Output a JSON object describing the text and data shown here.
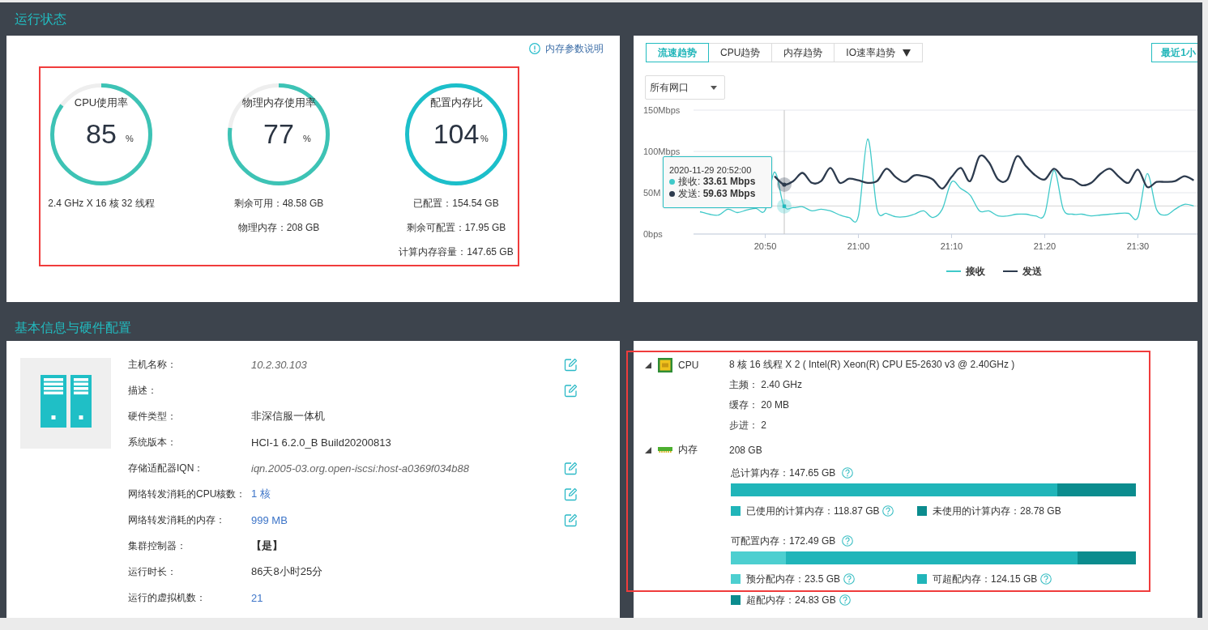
{
  "runtime": {
    "title": "运行状态",
    "help_link": "内存参数说明",
    "highlighted": true,
    "gauges": [
      {
        "label": "CPU使用率",
        "value": "85",
        "unit": "%",
        "level": 0.85,
        "color": "#3dc3b5",
        "details": [
          "2.4 GHz X 16 核 32 线程"
        ]
      },
      {
        "label": "物理内存使用率",
        "value": "77",
        "unit": "%",
        "level": 0.77,
        "color": "#3dc3b5",
        "details": [
          "剩余可用：48.58 GB",
          "物理内存：208 GB"
        ]
      },
      {
        "label": "配置内存比",
        "value": "104",
        "unit": "%",
        "level": 1,
        "color": "#1cbfca",
        "details": [
          "已配置：154.54 GB",
          "剩余可配置：17.95 GB",
          "计算内存容量：147.65 GB"
        ]
      }
    ]
  },
  "trend": {
    "tabs": [
      {
        "label": "流速趋势",
        "selected": true,
        "kind": "tab"
      },
      {
        "label": "CPU趋势",
        "selected": false,
        "kind": "tab"
      },
      {
        "label": "内存趋势",
        "selected": false,
        "kind": "tab"
      },
      {
        "label": "IO速率趋势",
        "selected": false,
        "kind": "dropdown"
      }
    ],
    "time_range": "最近1小",
    "interface_select": "所有网口",
    "chart_data": {
      "type": "line",
      "categories": [
        null,
        null,
        null,
        null,
        null,
        null,
        null,
        "20:50",
        null,
        null,
        null,
        null,
        null,
        null,
        null,
        null,
        null,
        "21:00",
        null,
        null,
        null,
        null,
        null,
        null,
        null,
        null,
        null,
        "21:10",
        null,
        null,
        null,
        null,
        null,
        null,
        null,
        null,
        null,
        "21:20",
        null,
        null,
        null,
        null,
        null,
        null,
        null,
        null,
        null,
        "21:30",
        null,
        null,
        null,
        null,
        null,
        null
      ],
      "ylim": [
        0,
        150
      ],
      "yticks": [
        {
          "value": 0,
          "label": "0bps"
        },
        {
          "value": 50,
          "label": "50M"
        },
        {
          "value": 100,
          "label": "100Mbps"
        },
        {
          "value": 150,
          "label": "150Mbps"
        }
      ],
      "legend": "bottom",
      "series": [
        {
          "name": "接收",
          "color": "#3fc9c9",
          "values": [
            27,
            24,
            23,
            30,
            26,
            29,
            31,
            29,
            75,
            34,
            32,
            33,
            28,
            30,
            28,
            23,
            20,
            22,
            115,
            30,
            25,
            21,
            21,
            24,
            28,
            20,
            30,
            63,
            55,
            47,
            28,
            28,
            22,
            22,
            24,
            24,
            22,
            24,
            77,
            30,
            24,
            24,
            22,
            23,
            24,
            25,
            25,
            20,
            73,
            30,
            23,
            30,
            36,
            34
          ]
        },
        {
          "name": "发送",
          "color": "#2d3b4e",
          "values": [
            null,
            null,
            null,
            null,
            null,
            null,
            null,
            null,
            70,
            60,
            64,
            74,
            62,
            64,
            80,
            62,
            67,
            65,
            62,
            64,
            79,
            69,
            63,
            71,
            70,
            66,
            55,
            69,
            80,
            64,
            94,
            87,
            66,
            66,
            94,
            82,
            71,
            66,
            79,
            68,
            66,
            59,
            62,
            73,
            79,
            69,
            62,
            78,
            57,
            63,
            63,
            64,
            70,
            65
          ]
        }
      ],
      "ref_lines": [
        {
          "axis": "y",
          "value": 34
        }
      ]
    },
    "tooltip": {
      "title": "2020-11-29 20:52:00",
      "rows": [
        "接收: **33.61 Mbps**",
        "发送: **59.63 Mbps**"
      ]
    }
  },
  "basic_info": {
    "title": "基本信息与硬件配置",
    "fields": [
      {
        "label": "主机名称：",
        "value": "10.2.30.103",
        "kind": "italic",
        "editable": true
      },
      {
        "label": "描述：",
        "editable": true
      },
      {
        "label": "硬件类型：",
        "value": "非深信服一体机",
        "kind": "plain",
        "editable": false
      },
      {
        "label": "系统版本：",
        "value": "HCI-1 6.2.0_B Build20200813",
        "kind": "plain",
        "editable": false
      },
      {
        "label": "存储适配器IQN：",
        "value": "iqn.2005-03.org.open-iscsi:host-a0369f034b88",
        "kind": "italic",
        "editable": true
      },
      {
        "label": "网络转发消耗的CPU核数：",
        "value": "1 核",
        "kind": "link",
        "editable": true
      },
      {
        "label": "网络转发消耗的内存：",
        "value": "999 MB",
        "kind": "link",
        "editable": true
      },
      {
        "label": "集群控制器：",
        "value": "【是】",
        "kind": "bold",
        "editable": false
      },
      {
        "label": "运行时长：",
        "value": "86天8小时25分",
        "kind": "plain",
        "editable": false
      },
      {
        "label": "运行的虚拟机数：",
        "value": "21",
        "kind": "link",
        "editable": false
      }
    ]
  },
  "hardware": {
    "highlighted": true,
    "items": [
      {
        "kind": "cpu",
        "name": "CPU",
        "expanded": true,
        "summary": "8 核 16 线程 X 2 ( Intel(R) Xeon(R) CPU E5-2630 v3 @ 2.40GHz )",
        "details": [
          "主频： 2.40 GHz",
          "缓存： 20 MB",
          "步进： 2"
        ]
      },
      {
        "kind": "memory",
        "name": "内存",
        "expanded": true,
        "summary": "208 GB",
        "bars": [
          {
            "title": "总计算内存：147.65 GB",
            "help": true,
            "segments": [
              {
                "kind": "left",
                "label": "已使用的计算内存：118.87 GB",
                "level": 0.805,
                "color": "#20b5b9",
                "help": true
              },
              {
                "kind": "track",
                "label": "未使用的计算内存：28.78 GB",
                "color": "#0b8c8e",
                "help": false
              }
            ]
          },
          {
            "title": "可配置内存：172.49 GB",
            "help": true,
            "segments": [
              {
                "kind": "left",
                "label": "预分配内存：23.5 GB",
                "level": 0.136,
                "color": "#4dcfd0",
                "help": true
              },
              {
                "kind": "track",
                "label": "可超配内存：124.15 GB",
                "color": "#20b5b9",
                "help": true
              },
              {
                "kind": "right",
                "label": "超配内存：24.83 GB",
                "level": 0.144,
                "color": "#0b8c8e",
                "help": true
              }
            ]
          }
        ]
      }
    ]
  }
}
